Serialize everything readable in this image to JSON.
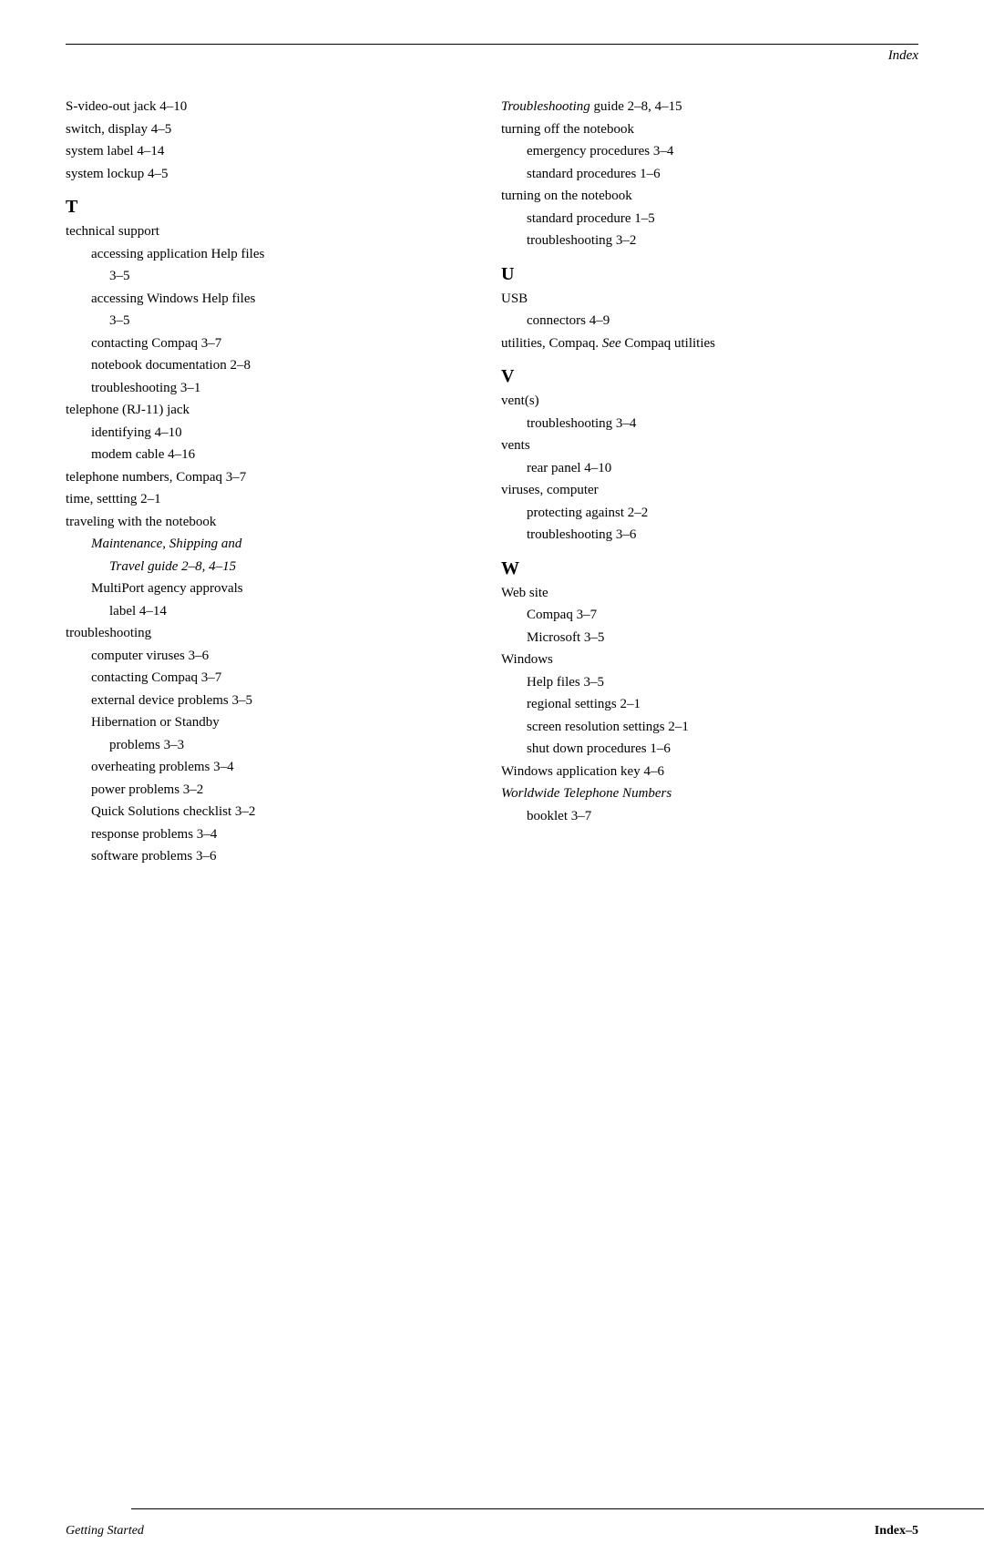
{
  "header": {
    "title": "Index"
  },
  "footer": {
    "left": "Getting Started",
    "right": "Index–5"
  },
  "left_column": [
    {
      "type": "entry-main",
      "text": "S-video-out jack 4–10"
    },
    {
      "type": "entry-main",
      "text": "switch, display 4–5"
    },
    {
      "type": "entry-main",
      "text": "system label 4–14"
    },
    {
      "type": "entry-main",
      "text": "system lockup 4–5"
    },
    {
      "type": "heading",
      "text": "T"
    },
    {
      "type": "entry-main",
      "text": "technical support"
    },
    {
      "type": "entry-sub",
      "text": "accessing application Help files"
    },
    {
      "type": "entry-sub2",
      "text": "3–5"
    },
    {
      "type": "entry-sub",
      "text": "accessing Windows Help files"
    },
    {
      "type": "entry-sub2",
      "text": "3–5"
    },
    {
      "type": "entry-sub",
      "text": "contacting Compaq 3–7"
    },
    {
      "type": "entry-sub",
      "text": "notebook documentation 2–8"
    },
    {
      "type": "entry-sub",
      "text": "troubleshooting 3–1"
    },
    {
      "type": "entry-main",
      "text": "telephone (RJ-11) jack"
    },
    {
      "type": "entry-sub",
      "text": "identifying 4–10"
    },
    {
      "type": "entry-sub",
      "text": "modem cable 4–16"
    },
    {
      "type": "entry-main",
      "text": "telephone numbers, Compaq 3–7"
    },
    {
      "type": "entry-main",
      "text": "time, settting 2–1"
    },
    {
      "type": "entry-main",
      "text": "traveling with the notebook"
    },
    {
      "type": "entry-sub italic",
      "text": "Maintenance, Shipping and"
    },
    {
      "type": "entry-sub2 italic",
      "text": "Travel guide 2–8, 4–15"
    },
    {
      "type": "entry-sub",
      "text": "MultiPort agency approvals"
    },
    {
      "type": "entry-sub2",
      "text": "label 4–14"
    },
    {
      "type": "entry-main",
      "text": "troubleshooting"
    },
    {
      "type": "entry-sub",
      "text": "computer viruses 3–6"
    },
    {
      "type": "entry-sub",
      "text": "contacting Compaq 3–7"
    },
    {
      "type": "entry-sub",
      "text": "external device problems 3–5"
    },
    {
      "type": "entry-sub",
      "text": "Hibernation or Standby"
    },
    {
      "type": "entry-sub2",
      "text": "problems 3–3"
    },
    {
      "type": "entry-sub",
      "text": "overheating problems 3–4"
    },
    {
      "type": "entry-sub",
      "text": "power problems 3–2"
    },
    {
      "type": "entry-sub",
      "text": "Quick Solutions checklist 3–2"
    },
    {
      "type": "entry-sub",
      "text": "response problems 3–4"
    },
    {
      "type": "entry-sub",
      "text": "software problems 3–6"
    }
  ],
  "right_column": [
    {
      "type": "entry-main italic-first",
      "text_italic": "Troubleshooting",
      "text_normal": " guide 2–8, 4–15"
    },
    {
      "type": "entry-main",
      "text": "turning off the notebook"
    },
    {
      "type": "entry-sub",
      "text": "emergency procedures 3–4"
    },
    {
      "type": "entry-sub",
      "text": "standard procedures 1–6"
    },
    {
      "type": "entry-main",
      "text": "turning on the notebook"
    },
    {
      "type": "entry-sub",
      "text": "standard procedure 1–5"
    },
    {
      "type": "entry-sub",
      "text": "troubleshooting 3–2"
    },
    {
      "type": "heading",
      "text": "U"
    },
    {
      "type": "entry-main",
      "text": "USB"
    },
    {
      "type": "entry-sub",
      "text": "connectors 4–9"
    },
    {
      "type": "entry-main italic-see",
      "text_normal": "utilities, Compaq. ",
      "text_italic": "See",
      "text_normal2": " Compaq utilities"
    },
    {
      "type": "heading",
      "text": "V"
    },
    {
      "type": "entry-main",
      "text": "vent(s)"
    },
    {
      "type": "entry-sub",
      "text": "troubleshooting 3–4"
    },
    {
      "type": "entry-main",
      "text": "vents"
    },
    {
      "type": "entry-sub",
      "text": "rear panel 4–10"
    },
    {
      "type": "entry-main",
      "text": "viruses, computer"
    },
    {
      "type": "entry-sub",
      "text": "protecting against 2–2"
    },
    {
      "type": "entry-sub",
      "text": "troubleshooting 3–6"
    },
    {
      "type": "heading",
      "text": "W"
    },
    {
      "type": "entry-main",
      "text": "Web site"
    },
    {
      "type": "entry-sub",
      "text": "Compaq 3–7"
    },
    {
      "type": "entry-sub",
      "text": "Microsoft 3–5"
    },
    {
      "type": "entry-main",
      "text": "Windows"
    },
    {
      "type": "entry-sub",
      "text": "Help files 3–5"
    },
    {
      "type": "entry-sub",
      "text": "regional settings 2–1"
    },
    {
      "type": "entry-sub",
      "text": "screen resolution settings 2–1"
    },
    {
      "type": "entry-sub",
      "text": "shut down procedures 1–6"
    },
    {
      "type": "entry-main",
      "text": "Windows application key 4–6"
    },
    {
      "type": "entry-main italic",
      "text": "Worldwide Telephone Numbers"
    },
    {
      "type": "entry-sub",
      "text": "booklet 3–7"
    }
  ]
}
